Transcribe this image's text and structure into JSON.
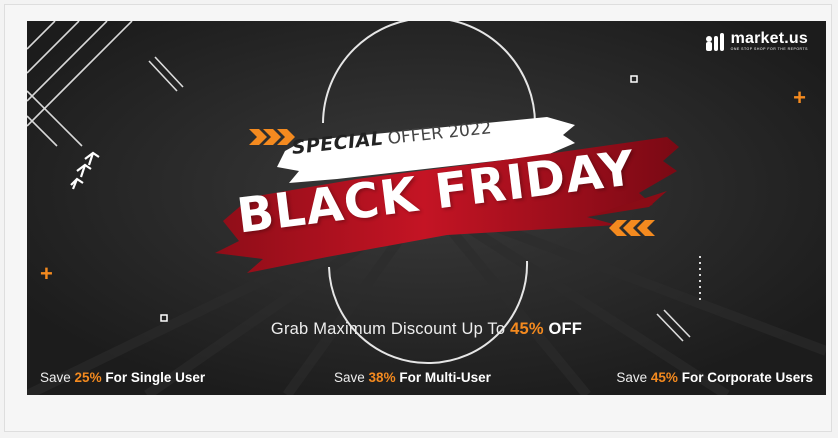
{
  "brand": {
    "name": "market.us",
    "tagline": "ONE STOP SHOP FOR THE REPORTS"
  },
  "headline": {
    "special_bold": "SPECIAL",
    "special_rest": "OFFER 2022",
    "title": "BLACK FRIDAY"
  },
  "offer": {
    "prefix": "Grab Maximum Discount Up To",
    "percent": "45%",
    "suffix": "OFF"
  },
  "plans": [
    {
      "prefix": "Save",
      "percent": "25%",
      "label": "For Single User"
    },
    {
      "prefix": "Save",
      "percent": "38%",
      "label": "For Multi-User"
    },
    {
      "prefix": "Save",
      "percent": "45%",
      "label": "For Corporate Users"
    }
  ],
  "decor": {
    "plus_symbol": "+",
    "accent_color": "#f48a1f",
    "splash_color": "#b0101e",
    "icons": [
      "arrows-right-icon",
      "arrows-left-icon",
      "plus-icon",
      "square-icon",
      "up-right-arrows-icon"
    ]
  }
}
